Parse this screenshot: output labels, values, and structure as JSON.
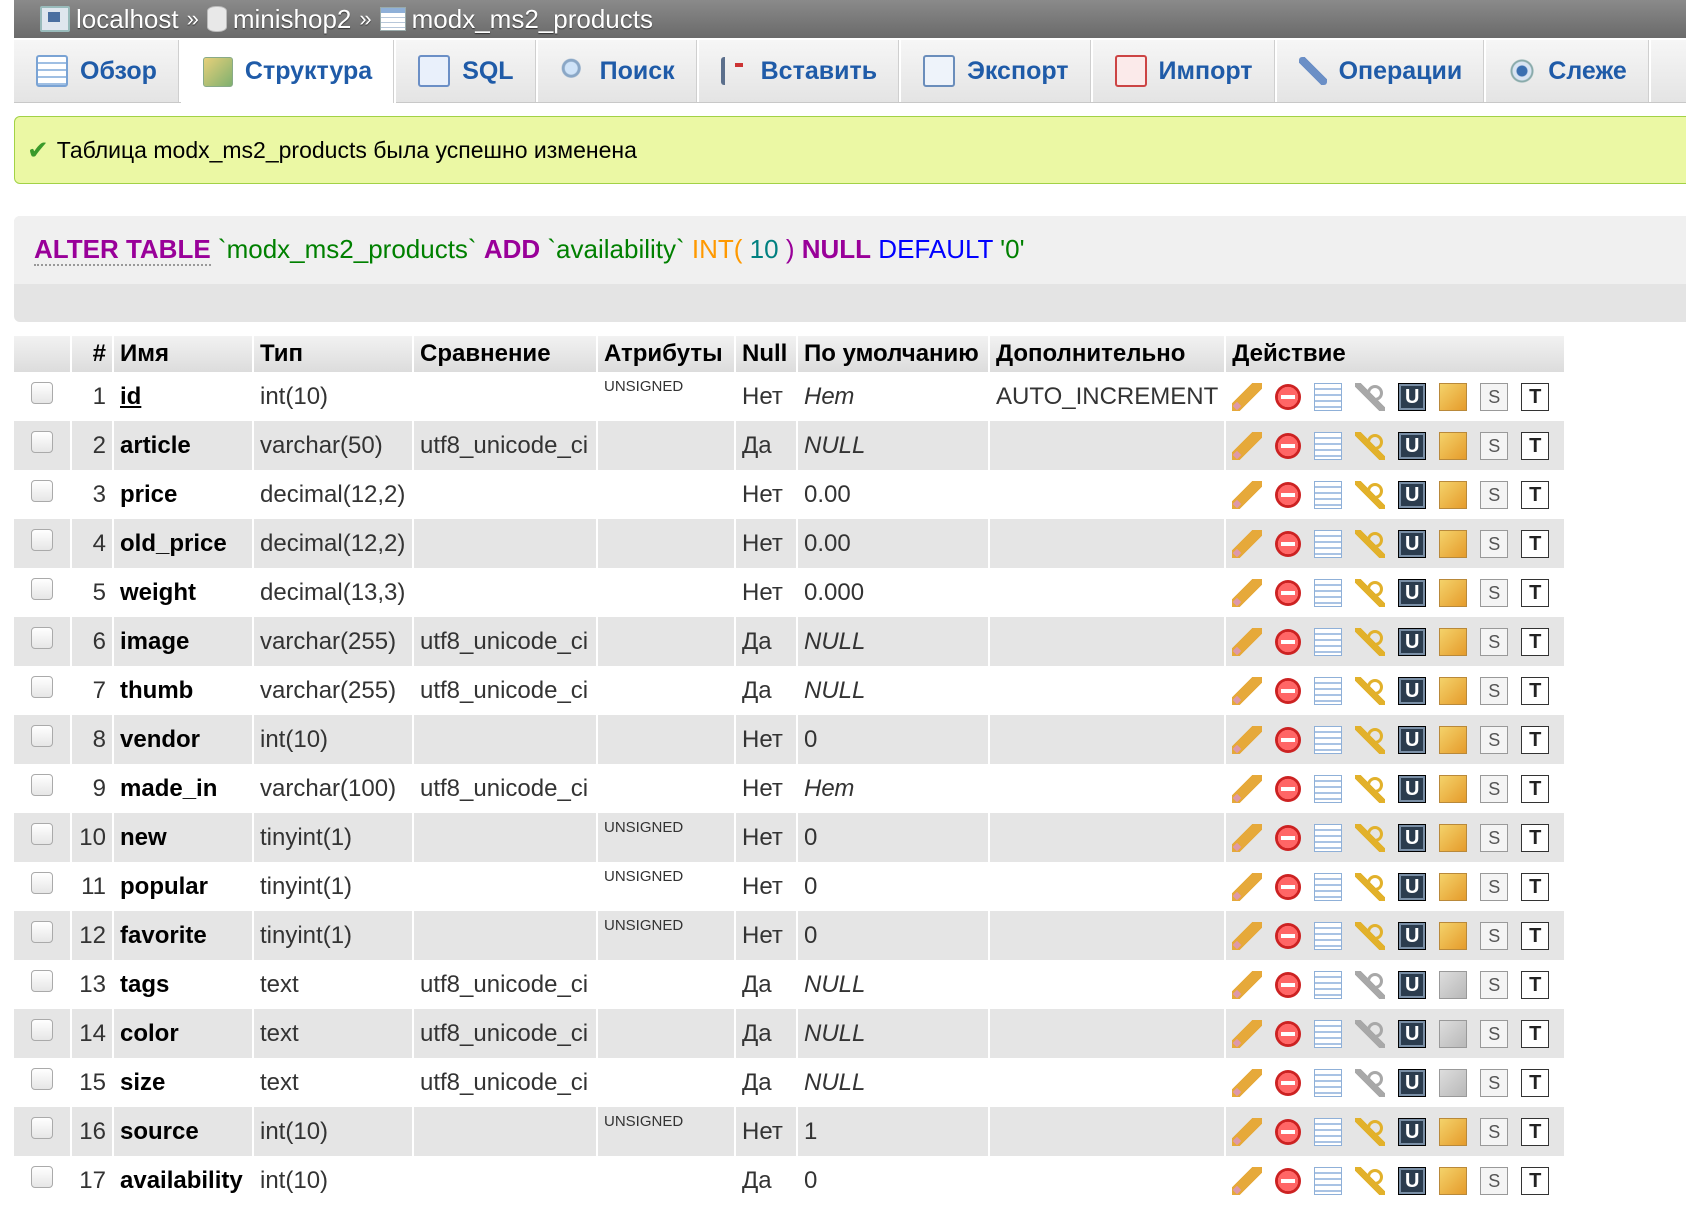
{
  "breadcrumb": {
    "server": "localhost",
    "database": "minishop2",
    "table": "modx_ms2_products",
    "separator": "»"
  },
  "tabs": [
    {
      "label": "Обзор",
      "icon": "browse-icon"
    },
    {
      "label": "Структура",
      "icon": "structure-icon",
      "active": true
    },
    {
      "label": "SQL",
      "icon": "sql-icon"
    },
    {
      "label": "Поиск",
      "icon": "search-icon"
    },
    {
      "label": "Вставить",
      "icon": "insert-icon"
    },
    {
      "label": "Экспорт",
      "icon": "export-icon"
    },
    {
      "label": "Импорт",
      "icon": "import-icon"
    },
    {
      "label": "Операции",
      "icon": "operations-icon"
    },
    {
      "label": "Слеже",
      "icon": "tracking-icon"
    }
  ],
  "message": {
    "text": "Таблица modx_ms2_products была успешно изменена",
    "icon": "checkmark-icon",
    "color": "#ebf8a4"
  },
  "sql": {
    "alter_table": "ALTER TABLE",
    "table_name": "`modx_ms2_products`",
    "add": "ADD",
    "column": "`availability`",
    "int": "INT(",
    "length": "10",
    "close": ")",
    "null": "NULL",
    "default": "DEFAULT",
    "default_value": "'0'"
  },
  "columns": {
    "num": "#",
    "name": "Имя",
    "type": "Тип",
    "collation": "Сравнение",
    "attributes": "Атрибуты",
    "null": "Null",
    "default": "По умолчанию",
    "extra": "Дополнительно",
    "action": "Действие"
  },
  "rows": [
    {
      "num": "1",
      "name": "id",
      "type": "int(10)",
      "collation": "",
      "attributes": "UNSIGNED",
      "null": "Нет",
      "default": "Нет",
      "default_italic": true,
      "extra": "AUTO_INCREMENT",
      "primary": true,
      "key_disabled": true,
      "spatial_disabled": false
    },
    {
      "num": "2",
      "name": "article",
      "type": "varchar(50)",
      "collation": "utf8_unicode_ci",
      "attributes": "",
      "null": "Да",
      "default": "NULL",
      "default_italic": true,
      "extra": "",
      "key_disabled": false,
      "spatial_disabled": false
    },
    {
      "num": "3",
      "name": "price",
      "type": "decimal(12,2)",
      "collation": "",
      "attributes": "",
      "null": "Нет",
      "default": "0.00",
      "default_italic": false,
      "extra": "",
      "key_disabled": false,
      "spatial_disabled": false
    },
    {
      "num": "4",
      "name": "old_price",
      "type": "decimal(12,2)",
      "collation": "",
      "attributes": "",
      "null": "Нет",
      "default": "0.00",
      "default_italic": false,
      "extra": "",
      "key_disabled": false,
      "spatial_disabled": false
    },
    {
      "num": "5",
      "name": "weight",
      "type": "decimal(13,3)",
      "collation": "",
      "attributes": "",
      "null": "Нет",
      "default": "0.000",
      "default_italic": false,
      "extra": "",
      "key_disabled": false,
      "spatial_disabled": false
    },
    {
      "num": "6",
      "name": "image",
      "type": "varchar(255)",
      "collation": "utf8_unicode_ci",
      "attributes": "",
      "null": "Да",
      "default": "NULL",
      "default_italic": true,
      "extra": "",
      "key_disabled": false,
      "spatial_disabled": false
    },
    {
      "num": "7",
      "name": "thumb",
      "type": "varchar(255)",
      "collation": "utf8_unicode_ci",
      "attributes": "",
      "null": "Да",
      "default": "NULL",
      "default_italic": true,
      "extra": "",
      "key_disabled": false,
      "spatial_disabled": false
    },
    {
      "num": "8",
      "name": "vendor",
      "type": "int(10)",
      "collation": "",
      "attributes": "",
      "null": "Нет",
      "default": "0",
      "default_italic": false,
      "extra": "",
      "key_disabled": false,
      "spatial_disabled": false
    },
    {
      "num": "9",
      "name": "made_in",
      "type": "varchar(100)",
      "collation": "utf8_unicode_ci",
      "attributes": "",
      "null": "Нет",
      "default": "Нет",
      "default_italic": true,
      "extra": "",
      "key_disabled": false,
      "spatial_disabled": false
    },
    {
      "num": "10",
      "name": "new",
      "type": "tinyint(1)",
      "collation": "",
      "attributes": "UNSIGNED",
      "null": "Нет",
      "default": "0",
      "default_italic": false,
      "extra": "",
      "key_disabled": false,
      "spatial_disabled": false
    },
    {
      "num": "11",
      "name": "popular",
      "type": "tinyint(1)",
      "collation": "",
      "attributes": "UNSIGNED",
      "null": "Нет",
      "default": "0",
      "default_italic": false,
      "extra": "",
      "key_disabled": false,
      "spatial_disabled": false
    },
    {
      "num": "12",
      "name": "favorite",
      "type": "tinyint(1)",
      "collation": "",
      "attributes": "UNSIGNED",
      "null": "Нет",
      "default": "0",
      "default_italic": false,
      "extra": "",
      "key_disabled": false,
      "spatial_disabled": false
    },
    {
      "num": "13",
      "name": "tags",
      "type": "text",
      "collation": "utf8_unicode_ci",
      "attributes": "",
      "null": "Да",
      "default": "NULL",
      "default_italic": true,
      "extra": "",
      "key_disabled": true,
      "spatial_disabled": true
    },
    {
      "num": "14",
      "name": "color",
      "type": "text",
      "collation": "utf8_unicode_ci",
      "attributes": "",
      "null": "Да",
      "default": "NULL",
      "default_italic": true,
      "extra": "",
      "key_disabled": true,
      "spatial_disabled": true
    },
    {
      "num": "15",
      "name": "size",
      "type": "text",
      "collation": "utf8_unicode_ci",
      "attributes": "",
      "null": "Да",
      "default": "NULL",
      "default_italic": true,
      "extra": "",
      "key_disabled": true,
      "spatial_disabled": true
    },
    {
      "num": "16",
      "name": "source",
      "type": "int(10)",
      "collation": "",
      "attributes": "UNSIGNED",
      "null": "Нет",
      "default": "1",
      "default_italic": false,
      "extra": "",
      "key_disabled": false,
      "spatial_disabled": false
    },
    {
      "num": "17",
      "name": "availability",
      "type": "int(10)",
      "collation": "",
      "attributes": "",
      "null": "Да",
      "default": "0",
      "default_italic": false,
      "extra": "",
      "key_disabled": false,
      "spatial_disabled": false
    }
  ],
  "action_icons": [
    "edit-icon",
    "drop-icon",
    "browse-values-icon",
    "primary-key-icon",
    "unique-icon",
    "spatial-index-icon",
    "fulltext-icon",
    "text-index-icon"
  ],
  "icon_glyphs": {
    "unique": "U",
    "fulltext": "S",
    "text": "T"
  }
}
